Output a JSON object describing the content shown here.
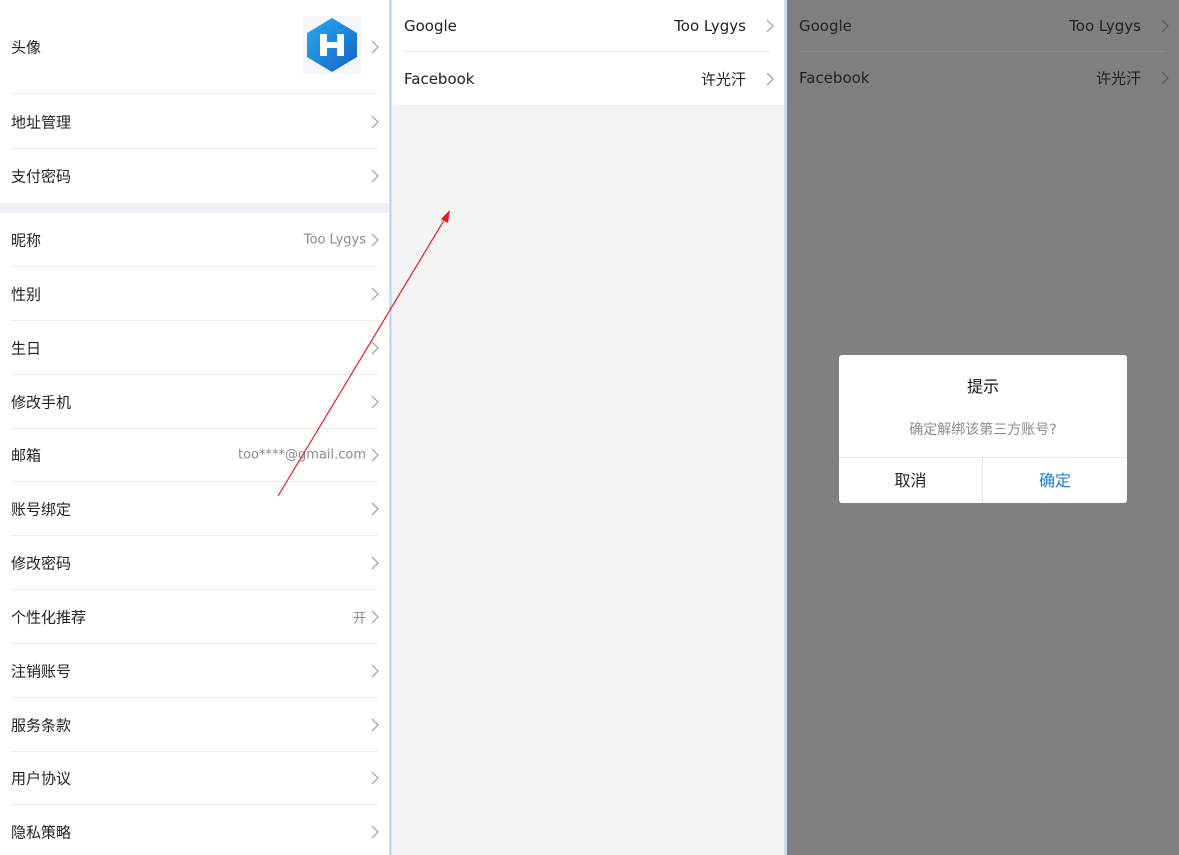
{
  "settings": {
    "avatar_label": "头像",
    "address_label": "地址管理",
    "pay_password_label": "支付密码",
    "nickname_label": "昵称",
    "nickname_value": "Too Lygys",
    "gender_label": "性别",
    "birthday_label": "生日",
    "phone_label": "修改手机",
    "email_label": "邮箱",
    "email_value": "too****@gmail.com",
    "account_binding_label": "账号绑定",
    "change_password_label": "修改密码",
    "personalization_label": "个性化推荐",
    "personalization_value": "开",
    "delete_account_label": "注销账号",
    "terms_label": "服务条款",
    "user_agreement_label": "用户协议",
    "privacy_label": "隐私策略"
  },
  "bindings": {
    "google_label": "Google",
    "google_value": "Too Lygys",
    "facebook_label": "Facebook",
    "facebook_value": "许光汗"
  },
  "dialog": {
    "title": "提示",
    "message": "确定解绑该第三方账号?",
    "cancel": "取消",
    "confirm": "确定"
  },
  "colors": {
    "accent": "#1a7fd6",
    "overlay": "#808080",
    "arrow": "#e02020"
  },
  "icons": {
    "chevron": "chevron-right-icon",
    "avatar": "app-logo-icon",
    "arrow": "annotation-arrow-icon"
  }
}
